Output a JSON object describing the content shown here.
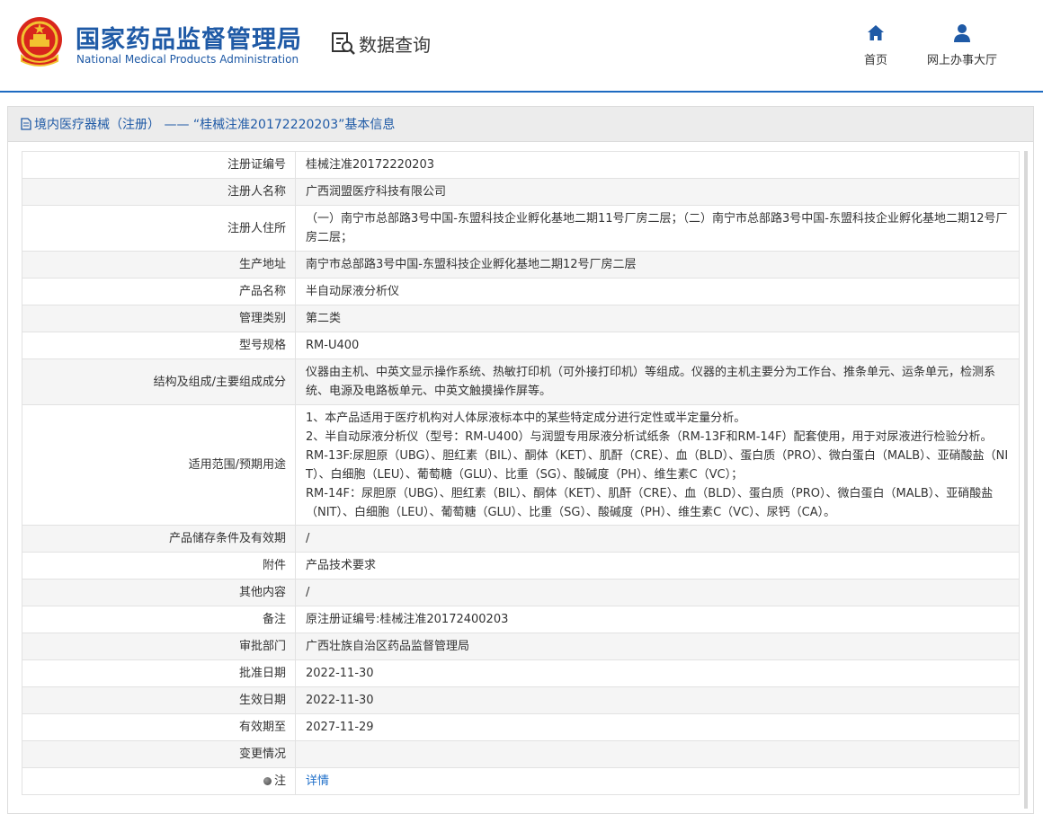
{
  "header": {
    "agency_cn": "国家药品监督管理局",
    "agency_en": "National Medical Products Administration",
    "data_query": "数据查询",
    "nav": [
      {
        "label": "首页",
        "icon": "home-icon"
      },
      {
        "label": "网上办事大厅",
        "icon": "user-icon"
      }
    ]
  },
  "colors": {
    "brand": "#1f5aa6",
    "link": "#1f6fc9",
    "emblem_red": "#d8261c",
    "emblem_gold": "#f2c230"
  },
  "panel": {
    "title": "境内医疗器械（注册） —— “桂械注准20172220203”基本信息",
    "icon": "document-icon"
  },
  "rows": [
    {
      "key": "注册证编号",
      "value": "桂械注准20172220203"
    },
    {
      "key": "注册人名称",
      "value": "广西润盟医疗科技有限公司"
    },
    {
      "key": "注册人住所",
      "value": "（一）南宁市总部路3号中国-东盟科技企业孵化基地二期11号厂房二层；（二）南宁市总部路3号中国-东盟科技企业孵化基地二期12号厂房二层；"
    },
    {
      "key": "生产地址",
      "value": "南宁市总部路3号中国-东盟科技企业孵化基地二期12号厂房二层"
    },
    {
      "key": "产品名称",
      "value": "半自动尿液分析仪"
    },
    {
      "key": "管理类别",
      "value": "第二类"
    },
    {
      "key": "型号规格",
      "value": "RM-U400"
    },
    {
      "key": "结构及组成/主要组成成分",
      "value": "仪器由主机、中英文显示操作系统、热敏打印机（可外接打印机）等组成。仪器的主机主要分为工作台、推条单元、运条单元，检测系统、电源及电路板单元、中英文触摸操作屏等。"
    },
    {
      "key": "适用范围/预期用途",
      "lines": [
        "1、本产品适用于医疗机构对人体尿液标本中的某些特定成分进行定性或半定量分析。",
        "2、半自动尿液分析仪（型号：RM-U400）与润盟专用尿液分析试纸条（RM-13F和RM-14F）配套使用，用于对尿液进行检验分析。",
        "RM-13F:尿胆原（UBG）、胆红素（BIL）、酮体（KET）、肌酐（CRE）、血（BLD）、蛋白质（PRO）、微白蛋白（MALB）、亚硝酸盐（NIT）、白细胞（LEU）、葡萄糖（GLU）、比重（SG）、酸碱度（PH）、维生素C（VC）；",
        "RM-14F：尿胆原（UBG）、胆红素（BIL）、酮体（KET）、肌酐（CRE）、血（BLD）、蛋白质（PRO）、微白蛋白（MALB）、亚硝酸盐（NIT）、白细胞（LEU）、葡萄糖（GLU）、比重（SG）、酸碱度（PH）、维生素C（VC）、尿钙（CA）。"
      ]
    },
    {
      "key": "产品储存条件及有效期",
      "value": "/"
    },
    {
      "key": "附件",
      "value": "产品技术要求"
    },
    {
      "key": "其他内容",
      "value": "/"
    },
    {
      "key": "备注",
      "value": "原注册证编号:桂械注准20172400203"
    },
    {
      "key": "审批部门",
      "value": "广西壮族自治区药品监督管理局"
    },
    {
      "key": "批准日期",
      "value": "2022-11-30"
    },
    {
      "key": "生效日期",
      "value": "2022-11-30"
    },
    {
      "key": "有效期至",
      "value": "2027-11-29"
    },
    {
      "key": "变更情况",
      "value": ""
    },
    {
      "key": "注",
      "value": "详情",
      "icon": "bullet-icon"
    }
  ]
}
